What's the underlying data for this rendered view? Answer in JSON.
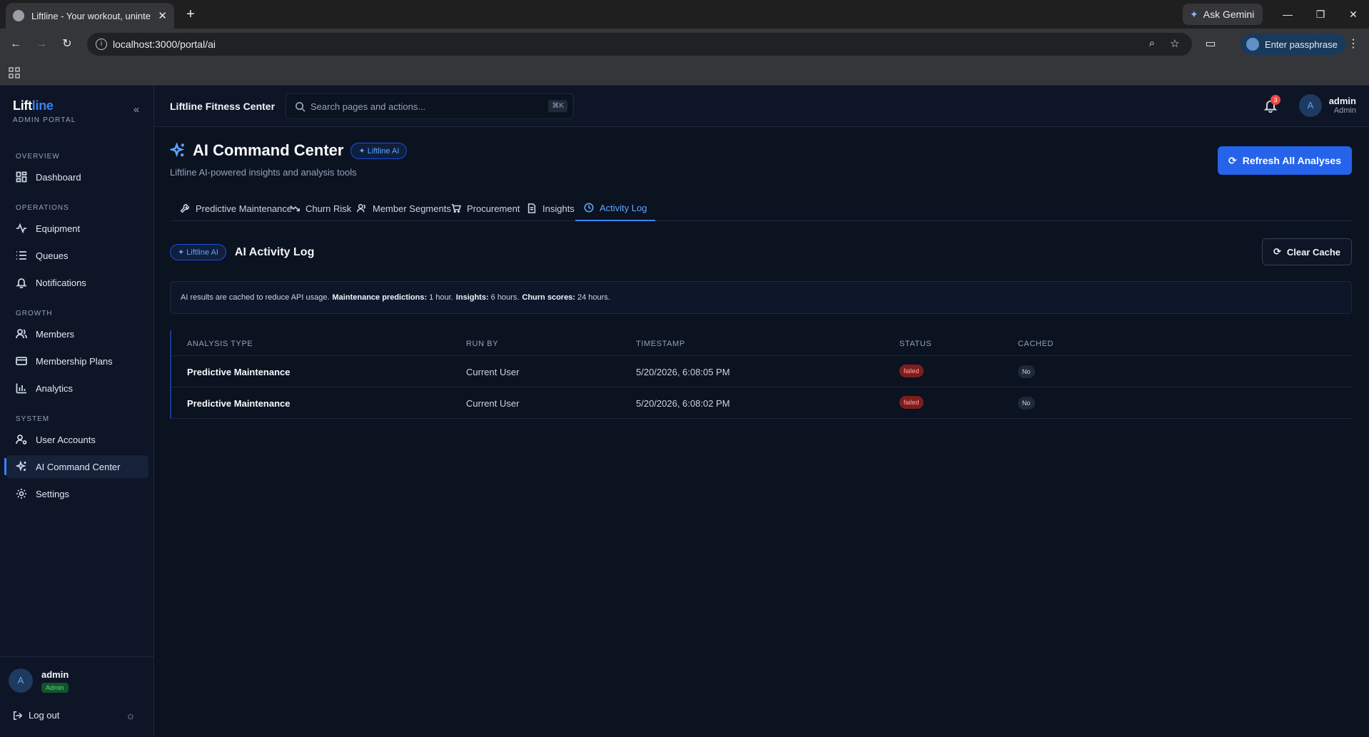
{
  "browser": {
    "tab_title": "Liftline - Your workout, unintern",
    "url": "localhost:3000/portal/ai",
    "gemini_label": "Ask Gemini",
    "passphrase_label": "Enter passphrase"
  },
  "sidebar": {
    "brand_main": "Lift",
    "brand_accent": "line",
    "brand_sub": "ADMIN PORTAL",
    "sections": {
      "overview": "OVERVIEW",
      "operations": "OPERATIONS",
      "growth": "GROWTH",
      "system": "SYSTEM"
    },
    "items": {
      "dashboard": "Dashboard",
      "equipment": "Equipment",
      "queues": "Queues",
      "notifications": "Notifications",
      "members": "Members",
      "plans": "Membership Plans",
      "analytics": "Analytics",
      "users": "User Accounts",
      "ai": "AI Command Center",
      "settings": "Settings"
    },
    "user": {
      "initial": "A",
      "name": "admin",
      "role": "Admin"
    },
    "logout": "Log out"
  },
  "topbar": {
    "org_name": "Liftline Fitness Center",
    "search_placeholder": "Search pages and actions...",
    "search_shortcut": "⌘K",
    "notification_count": "3",
    "user_initial": "A",
    "user_name": "admin",
    "user_role": "Admin"
  },
  "page": {
    "title": "AI Command Center",
    "badge": "✦ Liftline AI",
    "subtitle": "Liftline AI-powered insights and analysis tools",
    "refresh_label": "Refresh All Analyses",
    "tabs": {
      "maintenance": "Predictive Maintenance",
      "churn": "Churn Risk",
      "segments": "Member Segments",
      "procurement": "Procurement",
      "insights": "Insights",
      "activity": "Activity Log"
    },
    "active_tab": "Activity Log"
  },
  "activity_log": {
    "badge": "✦ Liftline AI",
    "title": "AI Activity Log",
    "clear_label": "Clear Cache",
    "note_intro": "AI results are cached to reduce API usage.",
    "note_maint_label": "Maintenance predictions:",
    "note_maint_value": "1 hour.",
    "note_insights_label": "Insights:",
    "note_insights_value": "6 hours.",
    "note_churn_label": "Churn scores:",
    "note_churn_value": "24 hours.",
    "columns": {
      "type": "ANALYSIS TYPE",
      "run_by": "RUN BY",
      "timestamp": "TIMESTAMP",
      "status": "STATUS",
      "cached": "CACHED"
    },
    "rows": [
      {
        "type": "Predictive Maintenance",
        "run_by": "Current User",
        "timestamp": "5/20/2026, 6:08:05 PM",
        "status": "failed",
        "cached": "No"
      },
      {
        "type": "Predictive Maintenance",
        "run_by": "Current User",
        "timestamp": "5/20/2026, 6:08:02 PM",
        "status": "failed",
        "cached": "No"
      }
    ]
  },
  "colors": {
    "accent": "#3b82f6",
    "failed": "#7f1d1d",
    "background": "#0b1220"
  }
}
